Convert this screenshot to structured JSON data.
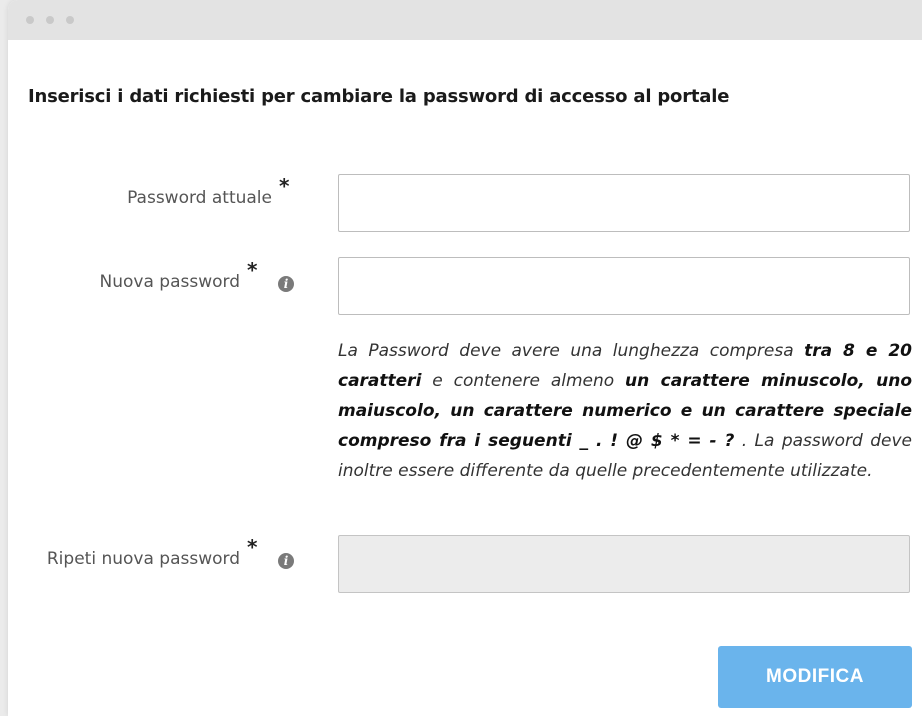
{
  "heading": "Inserisci i dati richiesti per cambiare la password di accesso al portale",
  "fields": {
    "current": {
      "label": "Password attuale",
      "required_mark": "*",
      "value": ""
    },
    "new": {
      "label": "Nuova password",
      "required_mark": "*",
      "info_icon": "info-icon",
      "value": ""
    },
    "repeat": {
      "label": "Ripeti nuova password",
      "required_mark": "*",
      "info_icon": "info-icon",
      "value": "",
      "disabled": true
    }
  },
  "hint": {
    "p1": "La Password deve avere una lunghezza compresa ",
    "b1": "tra 8 e 20 caratteri",
    "p2": " e contenere almeno ",
    "b2": "un carattere minuscolo, uno maiuscolo, un carattere numerico e un carattere speciale compreso fra i seguenti _ . ! @ $ * = - ?",
    "p3": " . La password deve inoltre essere differente da quelle precedentemente utilizzate."
  },
  "submit_label": "MODIFICA",
  "colors": {
    "accent": "#6ab4ec",
    "titlebar": "#e3e3e3"
  }
}
